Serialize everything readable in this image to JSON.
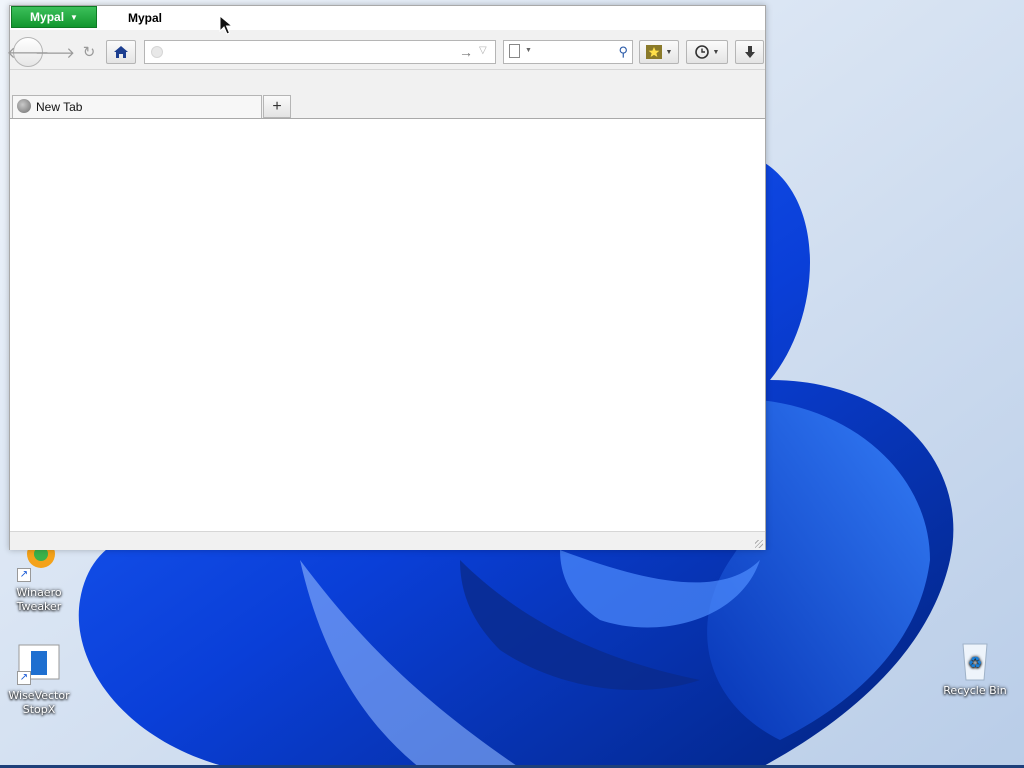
{
  "window": {
    "title": "Mypal",
    "app_menu_label": "Mypal"
  },
  "navbar": {
    "back_icon": "back-arrow-icon",
    "forward_icon": "forward-arrow-icon",
    "reload_icon": "reload-icon",
    "home_icon": "home-icon",
    "url_value": "",
    "url_placeholder": "",
    "search_value": "",
    "search_placeholder": "",
    "bookmarks_icon": "bookmarks-star-icon",
    "history_icon": "history-clock-icon",
    "downloads_icon": "download-arrow-icon"
  },
  "tabs": [
    {
      "label": "New Tab"
    }
  ],
  "new_tab_label": "+",
  "desktop": {
    "icons": [
      {
        "label": "Winaero Tweaker"
      },
      {
        "label": "WiseVector StopX"
      },
      {
        "label": "Recycle Bin"
      }
    ]
  },
  "colors": {
    "app_button": "#12962e",
    "wallpaper_blue": "#0a3fd8",
    "wallpaper_bg": "#dde8f4"
  }
}
